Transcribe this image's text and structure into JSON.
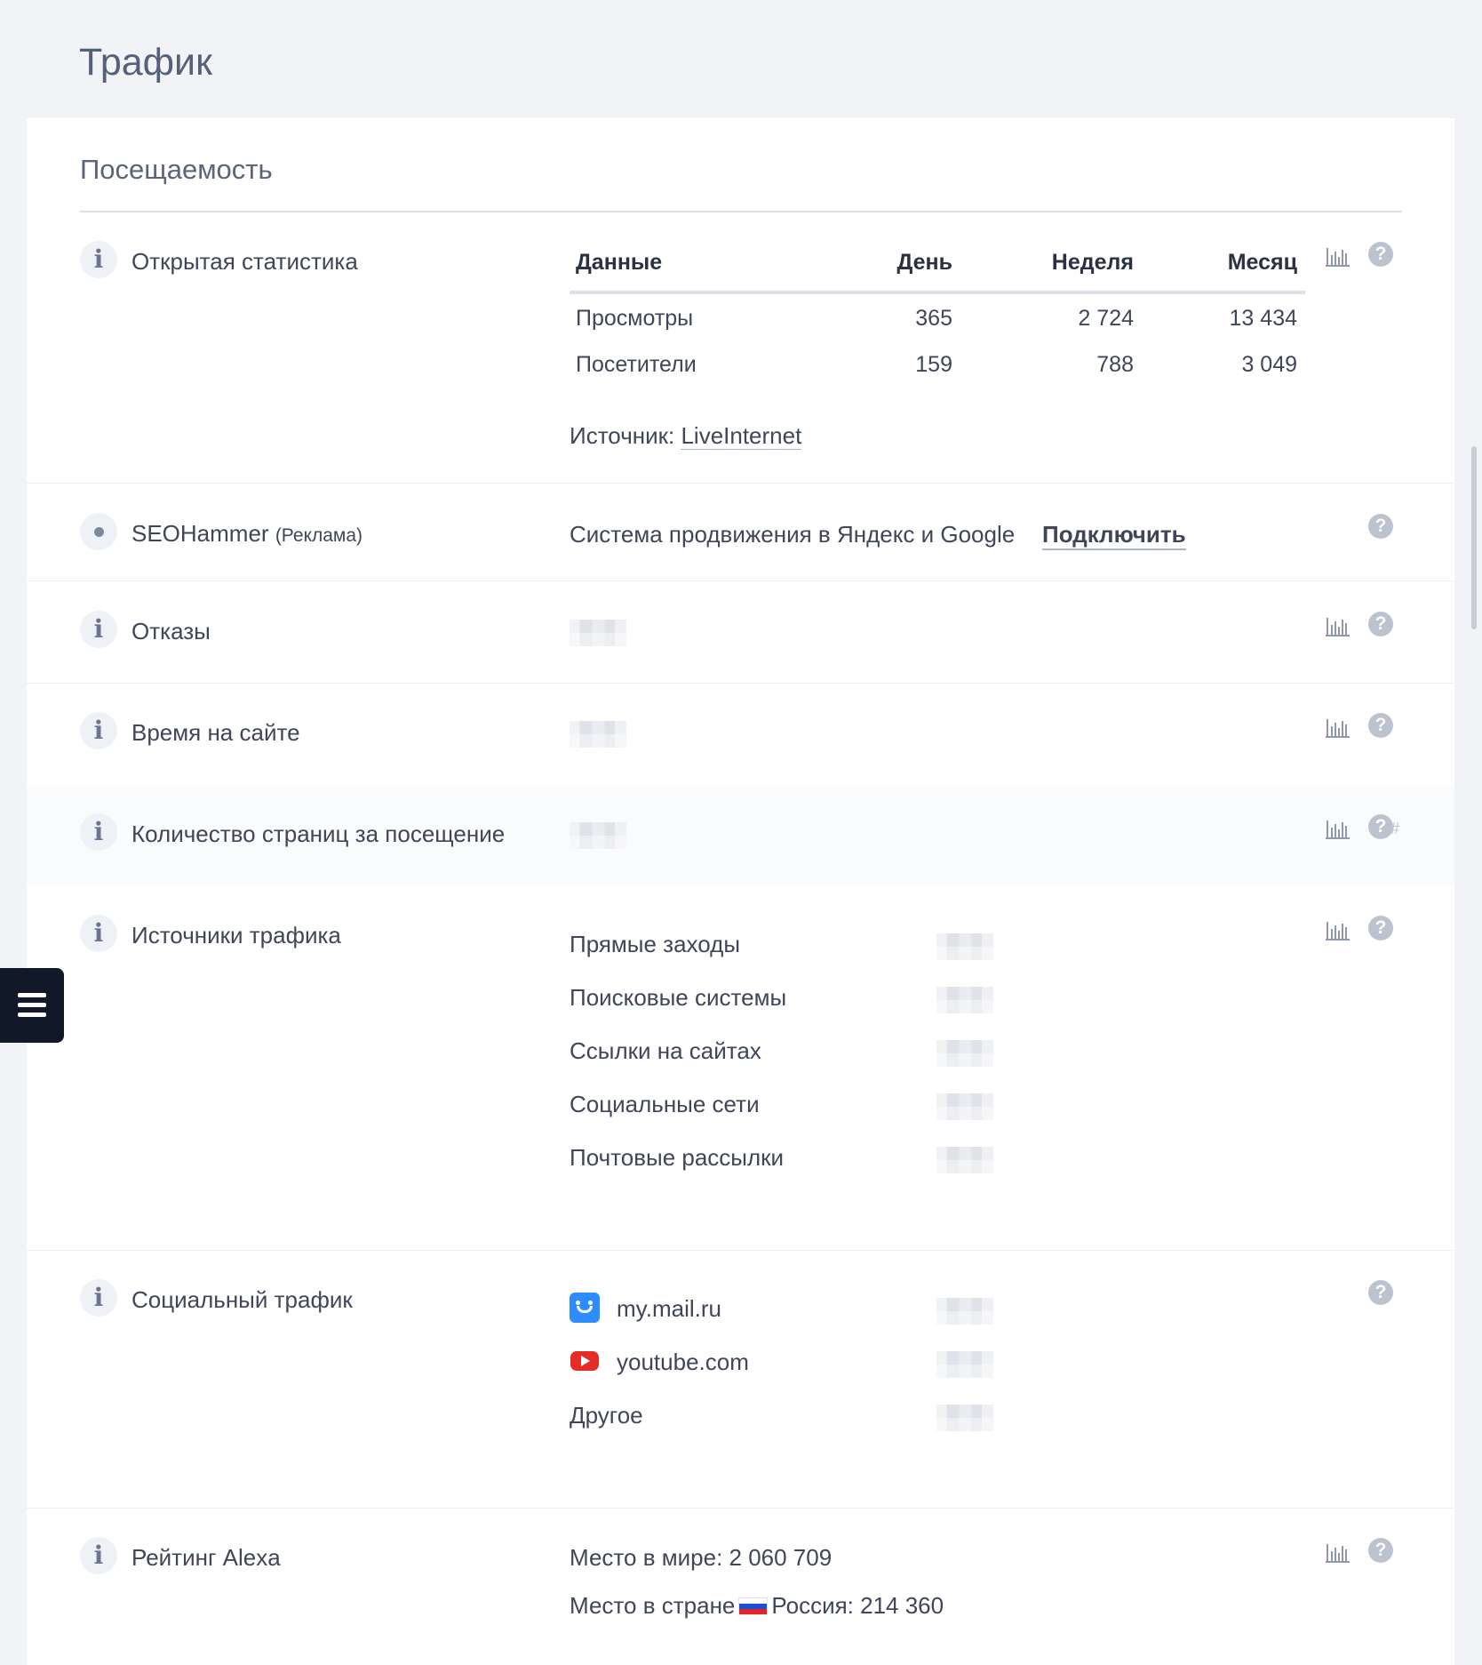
{
  "page_title": "Трафик",
  "section_title": "Посещаемость",
  "open_stats": {
    "label": "Открытая статистика",
    "headers": [
      "Данные",
      "День",
      "Неделя",
      "Месяц"
    ],
    "rows": [
      {
        "name": "Просмотры",
        "day": "365",
        "week": "2 724",
        "month": "13 434"
      },
      {
        "name": "Посетители",
        "day": "159",
        "week": "788",
        "month": "3 049"
      }
    ],
    "source_prefix": "Источник:",
    "source_link": "LiveInternet"
  },
  "seohammer": {
    "label": "SEOHammer",
    "tag": "(Реклама)",
    "description": "Система продвижения в Яндекс и Google",
    "cta": "Подключить"
  },
  "bounce": {
    "label": "Отказы"
  },
  "time_on_site": {
    "label": "Время на сайте"
  },
  "pages_per_visit": {
    "label": "Количество страниц за посещение"
  },
  "traffic_sources": {
    "label": "Источники трафика",
    "items": [
      "Прямые заходы",
      "Поисковые системы",
      "Ссылки на сайтах",
      "Социальные сети",
      "Почтовые рассылки"
    ]
  },
  "social_traffic": {
    "label": "Социальный трафик",
    "items": [
      {
        "name": "my.mail.ru",
        "icon": "my-mail-ru-icon"
      },
      {
        "name": "youtube.com",
        "icon": "youtube-icon"
      },
      {
        "name": "Другое",
        "icon": ""
      }
    ]
  },
  "alexa": {
    "label": "Рейтинг Alexa",
    "world_text": "Место в мире: 2 060 709",
    "country_prefix": "Место в стране",
    "country_text": "Россия: 214 360"
  },
  "icons": {
    "info": "info-icon",
    "chart": "bar-chart-icon",
    "help": "question-icon",
    "menu": "hamburger-menu-icon",
    "help_glyph": "?",
    "info_glyph": "i",
    "hash_glyph": "#"
  },
  "colors": {
    "page_bg": "#f1f3f7",
    "panel_bg": "#ffffff",
    "text": "#3f4658",
    "muted_icon": "#bcc3cf",
    "menu_bg": "#111827"
  }
}
